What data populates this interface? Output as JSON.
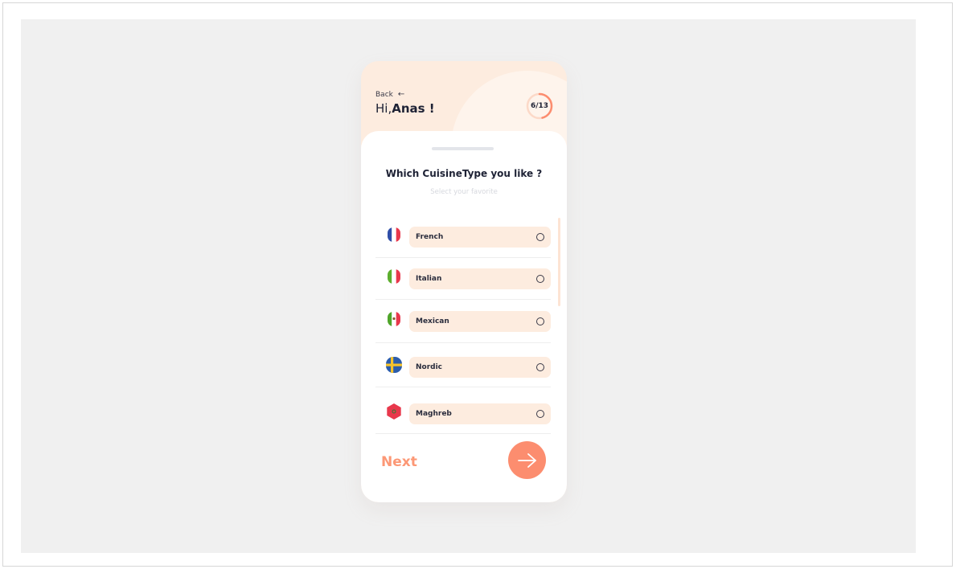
{
  "header": {
    "back_label": "Back",
    "back_icon": "arrow-left-icon",
    "greeting_prefix": "Hi,",
    "user_name": "Anas !",
    "progress_text": "6/13",
    "progress_fraction": 0.4615
  },
  "question": {
    "title": "Which CuisineType you like ?",
    "subtitle": "Select your favorite"
  },
  "cuisines": [
    {
      "label": "French",
      "flag_icon": "france-flag-icon",
      "selected": false
    },
    {
      "label": "Italian",
      "flag_icon": "italy-flag-icon",
      "selected": false
    },
    {
      "label": "Mexican",
      "flag_icon": "mexico-flag-icon",
      "selected": false
    },
    {
      "label": "Nordic",
      "flag_icon": "sweden-flag-icon",
      "selected": false
    },
    {
      "label": "Maghreb",
      "flag_icon": "morocco-flag-icon",
      "selected": false
    }
  ],
  "footer": {
    "next_label": "Next",
    "next_icon": "arrow-right-icon"
  },
  "colors": {
    "accent": "#fc8d6f",
    "header_bg": "#fdecdf",
    "pill_bg": "#fdecdf",
    "text_dark": "#1e2235"
  }
}
